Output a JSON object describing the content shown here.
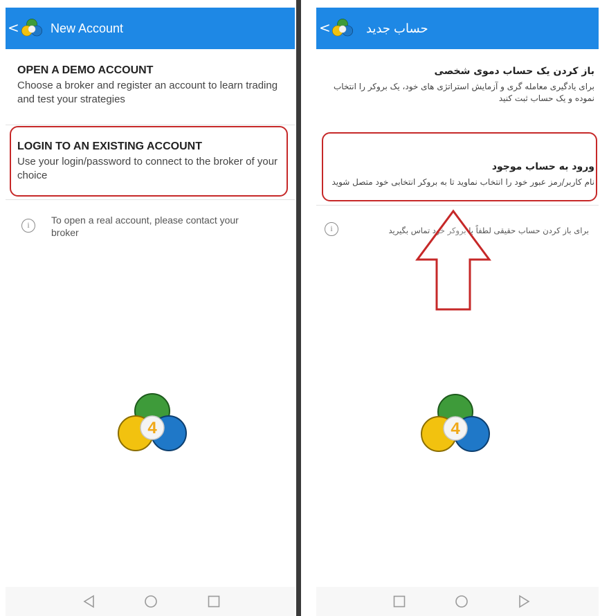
{
  "left_screen": {
    "header": {
      "back_glyph": "<",
      "title": "New Account",
      "logo_icon": "metatrader4-logo"
    },
    "options": [
      {
        "title": "OPEN A DEMO ACCOUNT",
        "description": "Choose a broker and register an account to learn trading and test your strategies"
      },
      {
        "title": "LOGIN TO AN EXISTING ACCOUNT",
        "description": "Use your login/password to connect to the broker of your choice"
      }
    ],
    "info": {
      "icon": "info-icon",
      "text": "To open a real account, please contact your broker"
    },
    "nav": [
      "back-triangle-icon",
      "home-circle-icon",
      "recents-square-icon"
    ]
  },
  "right_screen": {
    "header": {
      "back_glyph": "<",
      "title": "حساب جدید",
      "logo_icon": "metatrader4-logo"
    },
    "options": [
      {
        "title": "باز کردن یک حساب دموی شخصی",
        "description": "برای یادگیری معامله گری و آزمایش استراتژی های خود، یک بروکر را انتخاب نموده و یک حساب ثبت کنید"
      },
      {
        "title": "ورود به حساب موجود",
        "description": "نام کاربر/رمز عبور خود را انتخاب نماوید تا به بروکر انتخابی خود متصل شوید"
      }
    ],
    "info": {
      "icon": "info-icon",
      "text": "برای باز کردن حساب حقیقی لطفاً با بروکر خود تماس بگیرید"
    },
    "nav": [
      "recents-square-icon",
      "home-circle-icon",
      "back-triangle-icon"
    ]
  },
  "logo_number": "4",
  "colors": {
    "header": "#1e88e5",
    "highlight": "#c62828",
    "logo_green": "#3e9b3a",
    "logo_blue": "#1f78c8",
    "logo_yellow": "#f2c20f",
    "logo_number": "#f0a818"
  }
}
